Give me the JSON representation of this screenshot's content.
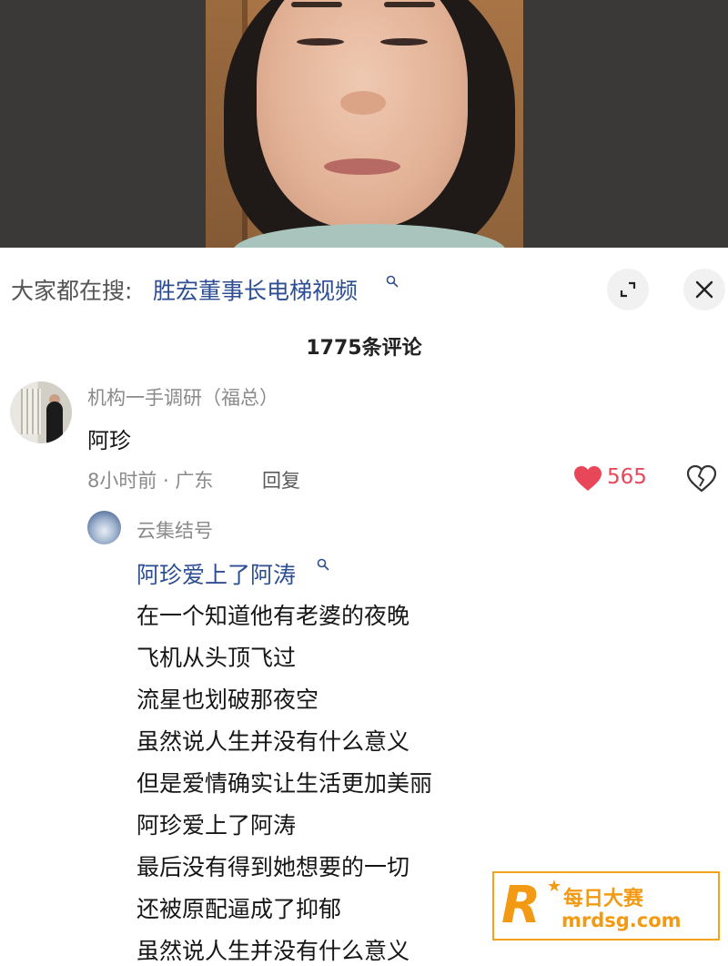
{
  "search": {
    "prefix": "大家都在搜:",
    "query": "胜宏董事长电梯视频"
  },
  "comments_header": {
    "count_label": "1775条评论"
  },
  "comment": {
    "author": "机构一手调研（福总）",
    "text": "阿珍",
    "meta": "8小时前 · 广东",
    "reply_label": "回复",
    "like_count": "565"
  },
  "reply": {
    "author": "云集结号",
    "link_text": "阿珍爱上了阿涛",
    "lines": [
      "在一个知道他有老婆的夜晚",
      "飞机从头顶飞过",
      "流星也划破那夜空",
      "虽然说人生并没有什么意义",
      "但是爱情确实让生活更加美丽",
      "阿珍爱上了阿涛",
      "最后没有得到她想要的一切",
      "还被原配逼成了抑郁",
      "虽然说人生并没有什么意义"
    ]
  },
  "watermark": {
    "logo_letter": "R",
    "name": "每日大赛",
    "url": "mrdsg.com"
  },
  "colors": {
    "link": "#2d4e93",
    "like": "#e8475a",
    "watermark": "#f29a13"
  },
  "icons": [
    "search-icon",
    "expand-icon",
    "close-icon",
    "heart-icon",
    "broken-heart-icon"
  ]
}
